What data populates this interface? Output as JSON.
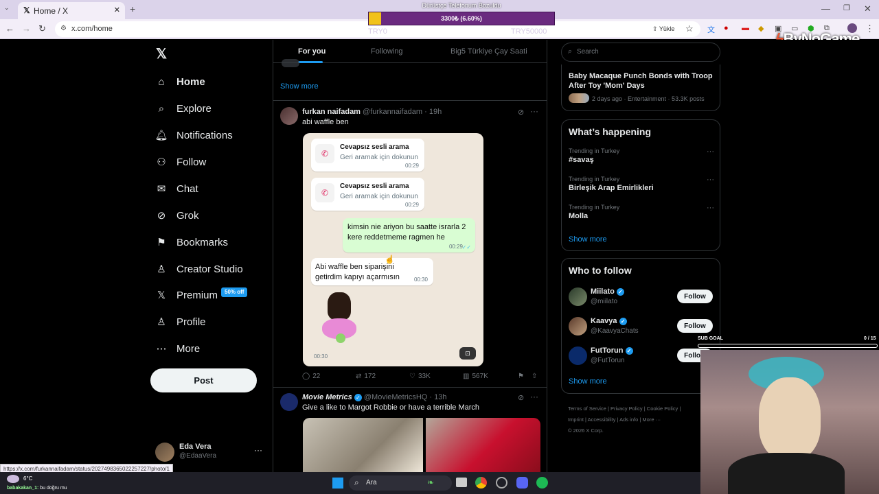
{
  "browser": {
    "tab_title": "Home / X",
    "url": "x.com/home",
    "upload_label": "Yükle",
    "status_url": "https://x.com/furkannaifadam/status/2027498365022257227/photo/1"
  },
  "overlay": {
    "goal_title": "Dürüstçe Telefonum Bozuldu",
    "goal_text": "3300₺ (6.60%)",
    "goal_progress": 0.066,
    "goal_min": "TRY0",
    "goal_max": "TRY50000",
    "brand": "ByNoGame",
    "subgoal_label": "SUB GOAL",
    "subgoal_count": "0 / 15"
  },
  "sidebar": {
    "items": [
      {
        "label": "Home",
        "icon": "home-icon"
      },
      {
        "label": "Explore",
        "icon": "search-icon"
      },
      {
        "label": "Notifications",
        "icon": "bell-icon"
      },
      {
        "label": "Follow",
        "icon": "person-plus-icon"
      },
      {
        "label": "Chat",
        "icon": "mail-icon"
      },
      {
        "label": "Grok",
        "icon": "grok-icon"
      },
      {
        "label": "Bookmarks",
        "icon": "bookmark-icon"
      },
      {
        "label": "Creator Studio",
        "icon": "creator-icon"
      },
      {
        "label": "Premium",
        "icon": "x-icon"
      },
      {
        "label": "Profile",
        "icon": "person-icon"
      },
      {
        "label": "More",
        "icon": "more-circle-icon"
      }
    ],
    "premium_badge": "50% off",
    "post_label": "Post",
    "user_name": "Eda Vera",
    "user_handle": "@EdaaVera"
  },
  "timeline": {
    "tabs": [
      "For you",
      "Following",
      "Big5 Türkiye Çay Saati"
    ],
    "show_more": "Show more",
    "post1": {
      "name": "furkan naifadam",
      "handle": "@furkannaifadam",
      "time": "19h",
      "text": "abi waffle ben",
      "replies": "22",
      "reposts": "172",
      "likes": "33K",
      "views": "567K",
      "chat": {
        "call1_title": "Cevapsız sesli arama",
        "call1_sub": "Geri aramak için dokunun",
        "call1_time": "00:29",
        "call2_title": "Cevapsız sesli arama",
        "call2_sub": "Geri aramak için dokunun",
        "call2_time": "00:29",
        "msg_out": "kimsin nie ariyon bu saatte israrla 2 kere reddetmeme ragmen he",
        "msg_out_time": "00:29",
        "msg_in": "Abi waffle ben siparişini getirdim kapıyı açarmısın",
        "msg_in_time": "00:30",
        "sticker_time": "00:30"
      }
    },
    "post2": {
      "name": "Movie Metrics",
      "handle": "@MovieMetricsHQ",
      "time": "13h",
      "text": "Give a like to Margot Robbie or have a terrible March"
    }
  },
  "right": {
    "search_placeholder": "Search",
    "news_title": "Baby Macaque Punch Bonds with Troop After Toy 'Mom' Days",
    "news_meta": "2 days ago · Entertainment · 53.3K posts",
    "whats_happening": "What’s happening",
    "trends": [
      {
        "label": "Trending in Turkey",
        "title": "#savaş"
      },
      {
        "label": "Trending in Turkey",
        "title": "Birleşik Arap Emirlikleri"
      },
      {
        "label": "Trending in Turkey",
        "title": "Molla"
      }
    ],
    "show_more": "Show more",
    "who_to_follow": "Who to follow",
    "follow_label": "Follow",
    "accounts": [
      {
        "name": "Miilato",
        "handle": "@miilato"
      },
      {
        "name": "Kaavya",
        "handle": "@KaavyaChats"
      },
      {
        "name": "FutTorun",
        "handle": "@FutTorun"
      }
    ],
    "footer_line1": [
      "Terms of Service",
      "Privacy Policy",
      "Cookie Policy"
    ],
    "footer_line2": [
      "Imprint",
      "Accessibility",
      "Ads info",
      "More ···"
    ],
    "copyright": "© 2026 X Corp."
  },
  "taskbar": {
    "weather": "6°C",
    "search": "Ara",
    "chat_user": "babakakan_1",
    "chat_msg": "bu doğru mu"
  }
}
